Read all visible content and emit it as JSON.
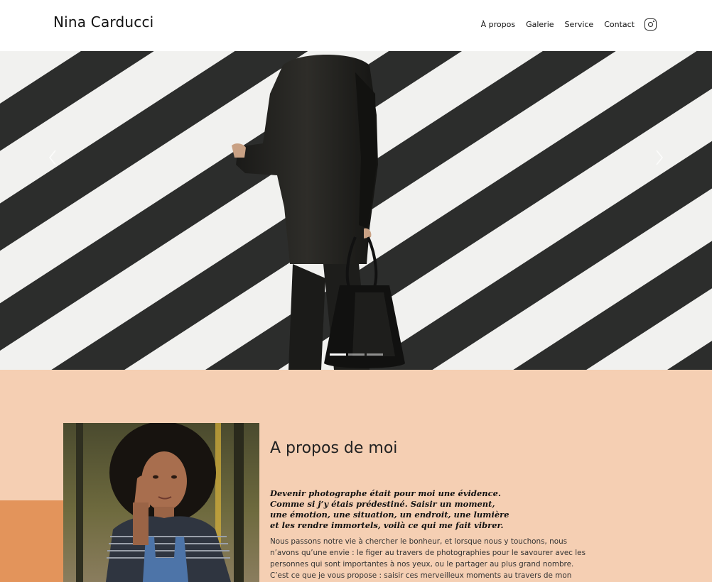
{
  "header": {
    "brand": "Nina Carducci",
    "nav": [
      {
        "label": "À propos"
      },
      {
        "label": "Galerie"
      },
      {
        "label": "Service"
      },
      {
        "label": "Contact"
      }
    ],
    "social_icon": "instagram-icon"
  },
  "hero": {
    "slide_count": 3,
    "active_slide": 1,
    "prev_icon": "chevron-left-icon",
    "next_icon": "chevron-right-icon"
  },
  "about": {
    "title": "A propos de moi",
    "quote": "Devenir photographe était pour moi une évidence. Comme si j’y étais prédestiné. Saisir un moment, une émotion, une situation, un endroit, une lumière et les rendre immortels, voilà ce qui me fait vibrer.",
    "text": "Nous passons notre vie à chercher le bonheur, et lorsque nous y touchons, nous n’avons qu’une envie : le figer au travers de photographies pour le savourer avec les personnes qui sont importantes à nos yeux, ou le partager au plus grand nombre. C’est ce que je vous propose : saisir ces merveilleux moments au travers de mon regard, mon approche,"
  },
  "colors": {
    "about_background": "#f5cfb3",
    "accent": "#e3945b"
  }
}
